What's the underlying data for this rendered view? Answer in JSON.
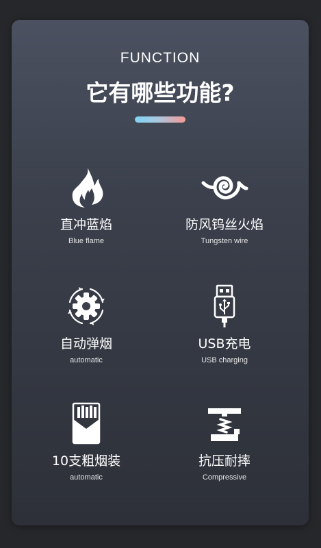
{
  "header": {
    "eyebrow": "FUNCTION",
    "title": "它有哪些功能?"
  },
  "accent_gradient": [
    "#7fd3f3",
    "#f39a94"
  ],
  "features": [
    {
      "icon": "flame-icon",
      "title_cn": "直冲蓝焰",
      "title_en": "Blue flame"
    },
    {
      "icon": "swirl-icon",
      "title_cn": "防风钨丝火焰",
      "title_en": "Tungsten wire"
    },
    {
      "icon": "gear-cycle-icon",
      "title_cn": "自动弹烟",
      "title_en": "automatic"
    },
    {
      "icon": "usb-icon",
      "title_cn": "USB充电",
      "title_en": "USB charging"
    },
    {
      "icon": "cigarette-pack-icon",
      "title_cn": "10支粗烟装",
      "title_en": "automatic"
    },
    {
      "icon": "press-icon",
      "title_cn": "抗压耐摔",
      "title_en": "Compressive"
    }
  ]
}
